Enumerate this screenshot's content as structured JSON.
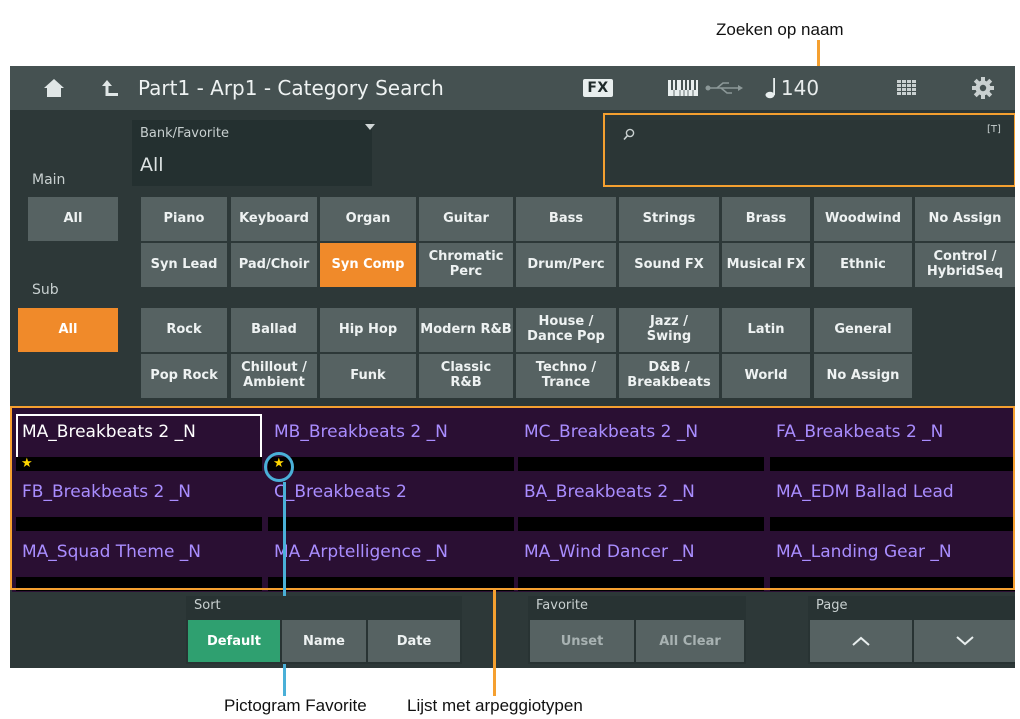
{
  "callouts": {
    "search_by_name": "Zoeken op naam",
    "favorite_icon": "Pictogram Favorite",
    "arp_list": "Lijst met arpeggiotypen"
  },
  "titlebar": {
    "title": "Part1 - Arp1 - Category Search",
    "fx_label": "FX",
    "tempo": "140",
    "icons": [
      "home-icon",
      "back-icon",
      "keyboard-icon",
      "usb-icon",
      "note-icon",
      "grid-icon",
      "gear-icon"
    ]
  },
  "main": {
    "main_label": "Main",
    "sub_label": "Sub",
    "bank_label": "Bank/Favorite",
    "bank_value": "All",
    "search_placeholder": "",
    "search_tag": "[T]"
  },
  "main_categories": [
    "All",
    "Piano",
    "Keyboard",
    "Organ",
    "Guitar",
    "Bass",
    "Strings",
    "Brass",
    "Woodwind",
    "No Assign",
    "Syn Lead",
    "Pad/Choir",
    "Syn Comp",
    "Chromatic Perc",
    "Drum/Perc",
    "Sound FX",
    "Musical FX",
    "Ethnic",
    "Control / HybridSeq"
  ],
  "sub_categories": [
    "All",
    "Rock",
    "Ballad",
    "Hip Hop",
    "Modern R&B",
    "House / Dance Pop",
    "Jazz / Swing",
    "Latin",
    "General",
    "Pop Rock",
    "Chillout / Ambient",
    "Funk",
    "Classic R&B",
    "Techno / Trance",
    "D&B / Breakbeats",
    "World",
    "No Assign"
  ],
  "selected": {
    "main": "Syn Comp",
    "sub": "All",
    "sort": "Default"
  },
  "list": [
    {
      "name": "MA_Breakbeats 2 _N",
      "favorite": true,
      "selected": true
    },
    {
      "name": "MB_Breakbeats 2 _N",
      "favorite": true,
      "selected": false
    },
    {
      "name": "MC_Breakbeats 2 _N",
      "favorite": false,
      "selected": false
    },
    {
      "name": "FA_Breakbeats 2 _N",
      "favorite": false,
      "selected": false
    },
    {
      "name": "FB_Breakbeats 2 _N",
      "favorite": false,
      "selected": false
    },
    {
      "name": "C_Breakbeats 2",
      "favorite": false,
      "selected": false
    },
    {
      "name": "BA_Breakbeats 2 _N",
      "favorite": false,
      "selected": false
    },
    {
      "name": "MA_EDM Ballad Lead",
      "favorite": false,
      "selected": false
    },
    {
      "name": "MA_Squad Theme _N",
      "favorite": false,
      "selected": false
    },
    {
      "name": "MA_Arptelligence _N",
      "favorite": false,
      "selected": false
    },
    {
      "name": "MA_Wind Dancer _N",
      "favorite": false,
      "selected": false
    },
    {
      "name": "MA_Landing Gear _N",
      "favorite": false,
      "selected": false
    }
  ],
  "bottom": {
    "sort_label": "Sort",
    "sort_default": "Default",
    "sort_name": "Name",
    "sort_date": "Date",
    "favorite_label": "Favorite",
    "fav_unset": "Unset",
    "fav_all_clear": "All Clear",
    "page_label": "Page"
  },
  "colors": {
    "accent_orange": "#f08a2a",
    "active_green": "#2fa070",
    "list_text": "#a98dff",
    "list_bg": "#2a0f33",
    "callout_line_blue": "#4ab0d8"
  }
}
